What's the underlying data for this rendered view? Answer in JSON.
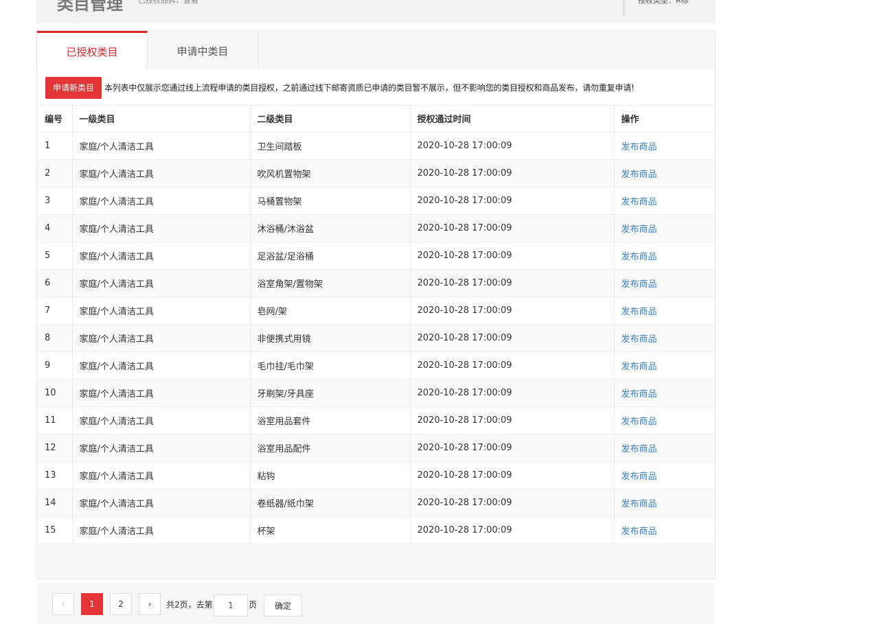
{
  "header": {
    "title": "类目管理",
    "subtitle": "已授权品牌，查看",
    "auth_type": "授权类型：R标"
  },
  "tabs": [
    {
      "label": "已授权类目",
      "active": true
    },
    {
      "label": "申请中类目",
      "active": false
    }
  ],
  "notice": {
    "apply_button": "申请新类目",
    "text": "本列表中仅展示您通过线上流程申请的类目授权，之前通过线下邮寄资质已申请的类目暂不展示，但不影响您的类目授权和商品发布，请勿重复申请!"
  },
  "table": {
    "columns": [
      "编号",
      "一级类目",
      "二级类目",
      "授权通过时间",
      "操作"
    ],
    "rows": [
      {
        "id": "1",
        "cat1": "家庭/个人清洁工具",
        "cat2": "卫生间踏板",
        "time": "2020-10-28 17:00:09",
        "action": "发布商品"
      },
      {
        "id": "2",
        "cat1": "家庭/个人清洁工具",
        "cat2": "吹风机置物架",
        "time": "2020-10-28 17:00:09",
        "action": "发布商品"
      },
      {
        "id": "3",
        "cat1": "家庭/个人清洁工具",
        "cat2": "马桶置物架",
        "time": "2020-10-28 17:00:09",
        "action": "发布商品"
      },
      {
        "id": "4",
        "cat1": "家庭/个人清洁工具",
        "cat2": "沐浴桶/沐浴盆",
        "time": "2020-10-28 17:00:09",
        "action": "发布商品"
      },
      {
        "id": "5",
        "cat1": "家庭/个人清洁工具",
        "cat2": "足浴盆/足浴桶",
        "time": "2020-10-28 17:00:09",
        "action": "发布商品"
      },
      {
        "id": "6",
        "cat1": "家庭/个人清洁工具",
        "cat2": "浴室角架/置物架",
        "time": "2020-10-28 17:00:09",
        "action": "发布商品"
      },
      {
        "id": "7",
        "cat1": "家庭/个人清洁工具",
        "cat2": "皂网/架",
        "time": "2020-10-28 17:00:09",
        "action": "发布商品"
      },
      {
        "id": "8",
        "cat1": "家庭/个人清洁工具",
        "cat2": "非便携式用镜",
        "time": "2020-10-28 17:00:09",
        "action": "发布商品"
      },
      {
        "id": "9",
        "cat1": "家庭/个人清洁工具",
        "cat2": "毛巾挂/毛巾架",
        "time": "2020-10-28 17:00:09",
        "action": "发布商品"
      },
      {
        "id": "10",
        "cat1": "家庭/个人清洁工具",
        "cat2": "牙刷架/牙具座",
        "time": "2020-10-28 17:00:09",
        "action": "发布商品"
      },
      {
        "id": "11",
        "cat1": "家庭/个人清洁工具",
        "cat2": "浴室用品套件",
        "time": "2020-10-28 17:00:09",
        "action": "发布商品"
      },
      {
        "id": "12",
        "cat1": "家庭/个人清洁工具",
        "cat2": "浴室用品配件",
        "time": "2020-10-28 17:00:09",
        "action": "发布商品"
      },
      {
        "id": "13",
        "cat1": "家庭/个人清洁工具",
        "cat2": "粘钩",
        "time": "2020-10-28 17:00:09",
        "action": "发布商品"
      },
      {
        "id": "14",
        "cat1": "家庭/个人清洁工具",
        "cat2": "卷纸器/纸巾架",
        "time": "2020-10-28 17:00:09",
        "action": "发布商品"
      },
      {
        "id": "15",
        "cat1": "家庭/个人清洁工具",
        "cat2": "杯架",
        "time": "2020-10-28 17:00:09",
        "action": "发布商品"
      }
    ]
  },
  "pager": {
    "prev": "‹",
    "pages": [
      "1",
      "2"
    ],
    "next": "›",
    "total_text": "共2页，去第",
    "input_value": "1",
    "page_suffix": "页",
    "confirm": "确定"
  },
  "colors": {
    "accent": "#e23434",
    "link": "#3a84c9"
  }
}
